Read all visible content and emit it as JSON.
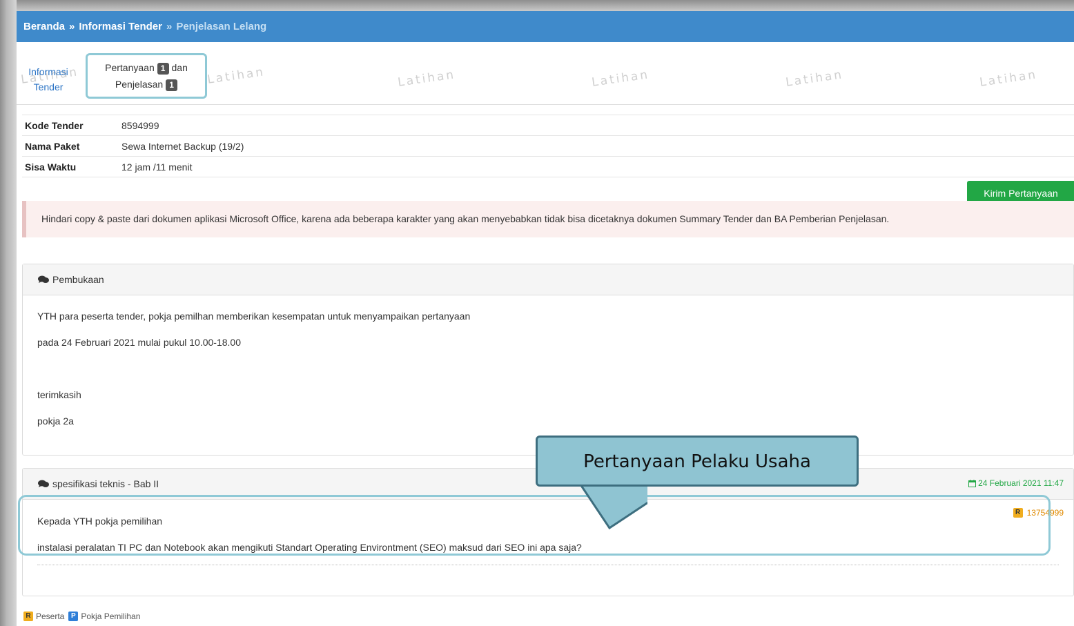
{
  "breadcrumb": {
    "home": "Beranda",
    "sep1": "»",
    "info": "Informasi Tender",
    "sep2": "»",
    "current": "Penjelasan Lelang"
  },
  "watermark": "Latihan",
  "tabs": {
    "info_line1": "Informasi",
    "info_line2": "Tender",
    "active_part1": "Pertanyaan",
    "active_badge1": "1",
    "active_part2": "dan",
    "active_part3": "Penjelasan",
    "active_badge2": "1"
  },
  "info": {
    "rows": [
      {
        "label": "Kode Tender",
        "value": "8594999"
      },
      {
        "label": "Nama Paket",
        "value": "Sewa Internet Backup (19/2)"
      },
      {
        "label": "Sisa Waktu",
        "value": "12 jam /11 menit"
      }
    ]
  },
  "kirim_button": "Kirim Pertanyaan",
  "alert": "Hindari copy & paste dari dokumen aplikasi Microsoft Office, karena ada beberapa karakter yang akan menyebabkan tidak bisa dicetaknya dokumen Summary Tender dan BA Pemberian Penjelasan.",
  "pembukaan": {
    "title": "Pembukaan",
    "lines": [
      "YTH para peserta tender, pokja pemilhan memberikan kesempatan untuk menyampaikan pertanyaan",
      "pada 24 Februari 2021 mulai pukul 10.00-18.00",
      "",
      "terimkasih",
      "pokja 2a"
    ]
  },
  "question": {
    "title": "spesifikasi teknis - Bab II",
    "date": "24 Februari 2021 11:47",
    "user_badge": "R",
    "user_id": "13754999",
    "lines": [
      "Kepada YTH pokja pemilihan",
      "instalasi peralatan TI PC dan Notebook akan mengikuti Standart Operating Environtment (SEO) maksud dari SEO ini apa saja?"
    ]
  },
  "callout": "Pertanyaan Pelaku Usaha",
  "legend": {
    "r_badge": "R",
    "r_label": "Peserta",
    "p_badge": "P",
    "p_label": "Pokja Pemilihan"
  },
  "colors": {
    "header": "#3f8acb",
    "button": "#22a745",
    "highlight": "#8fc9d6",
    "callout": "#8fc4d2"
  },
  "icons": {
    "comment": "comment-icon",
    "calendar": "calendar-icon"
  }
}
